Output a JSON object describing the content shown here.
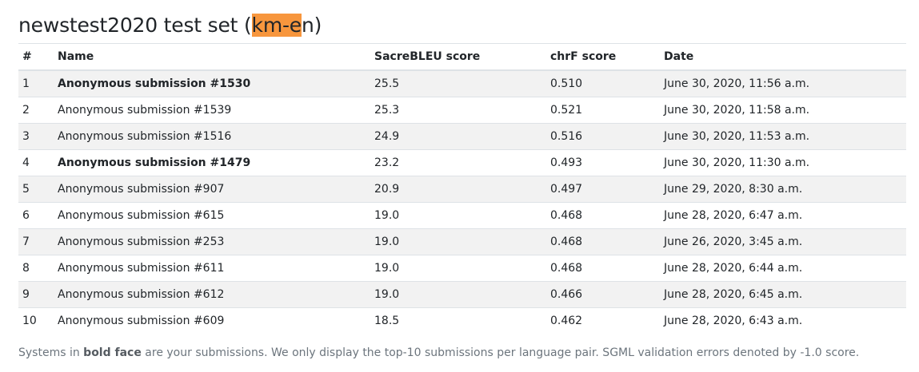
{
  "heading": {
    "prefix": "newstest2020 test set (",
    "highlight": "km-e",
    "suffix": "n)"
  },
  "columns": [
    "#",
    "Name",
    "SacreBLEU score",
    "chrF score",
    "Date"
  ],
  "rows": [
    {
      "rank": "1",
      "name": "Anonymous submission #1530",
      "bleu": "25.5",
      "chrf": "0.510",
      "date": "June 30, 2020, 11:56 a.m.",
      "bold": true
    },
    {
      "rank": "2",
      "name": "Anonymous submission #1539",
      "bleu": "25.3",
      "chrf": "0.521",
      "date": "June 30, 2020, 11:58 a.m.",
      "bold": false
    },
    {
      "rank": "3",
      "name": "Anonymous submission #1516",
      "bleu": "24.9",
      "chrf": "0.516",
      "date": "June 30, 2020, 11:53 a.m.",
      "bold": false
    },
    {
      "rank": "4",
      "name": "Anonymous submission #1479",
      "bleu": "23.2",
      "chrf": "0.493",
      "date": "June 30, 2020, 11:30 a.m.",
      "bold": true
    },
    {
      "rank": "5",
      "name": "Anonymous submission #907",
      "bleu": "20.9",
      "chrf": "0.497",
      "date": "June 29, 2020, 8:30 a.m.",
      "bold": false
    },
    {
      "rank": "6",
      "name": "Anonymous submission #615",
      "bleu": "19.0",
      "chrf": "0.468",
      "date": "June 28, 2020, 6:47 a.m.",
      "bold": false
    },
    {
      "rank": "7",
      "name": "Anonymous submission #253",
      "bleu": "19.0",
      "chrf": "0.468",
      "date": "June 26, 2020, 3:45 a.m.",
      "bold": false
    },
    {
      "rank": "8",
      "name": "Anonymous submission #611",
      "bleu": "19.0",
      "chrf": "0.468",
      "date": "June 28, 2020, 6:44 a.m.",
      "bold": false
    },
    {
      "rank": "9",
      "name": "Anonymous submission #612",
      "bleu": "19.0",
      "chrf": "0.466",
      "date": "June 28, 2020, 6:45 a.m.",
      "bold": false
    },
    {
      "rank": "10",
      "name": "Anonymous submission #609",
      "bleu": "18.5",
      "chrf": "0.462",
      "date": "June 28, 2020, 6:43 a.m.",
      "bold": false
    }
  ],
  "footer": {
    "pre": "Systems in ",
    "bold": "bold face",
    "post": " are your submissions. We only display the top-10 submissions per language pair. SGML validation errors denoted by -1.0 score."
  },
  "colors": {
    "highlight": "#f7963d",
    "stripe": "#f2f2f2",
    "border": "#dee2e6"
  }
}
